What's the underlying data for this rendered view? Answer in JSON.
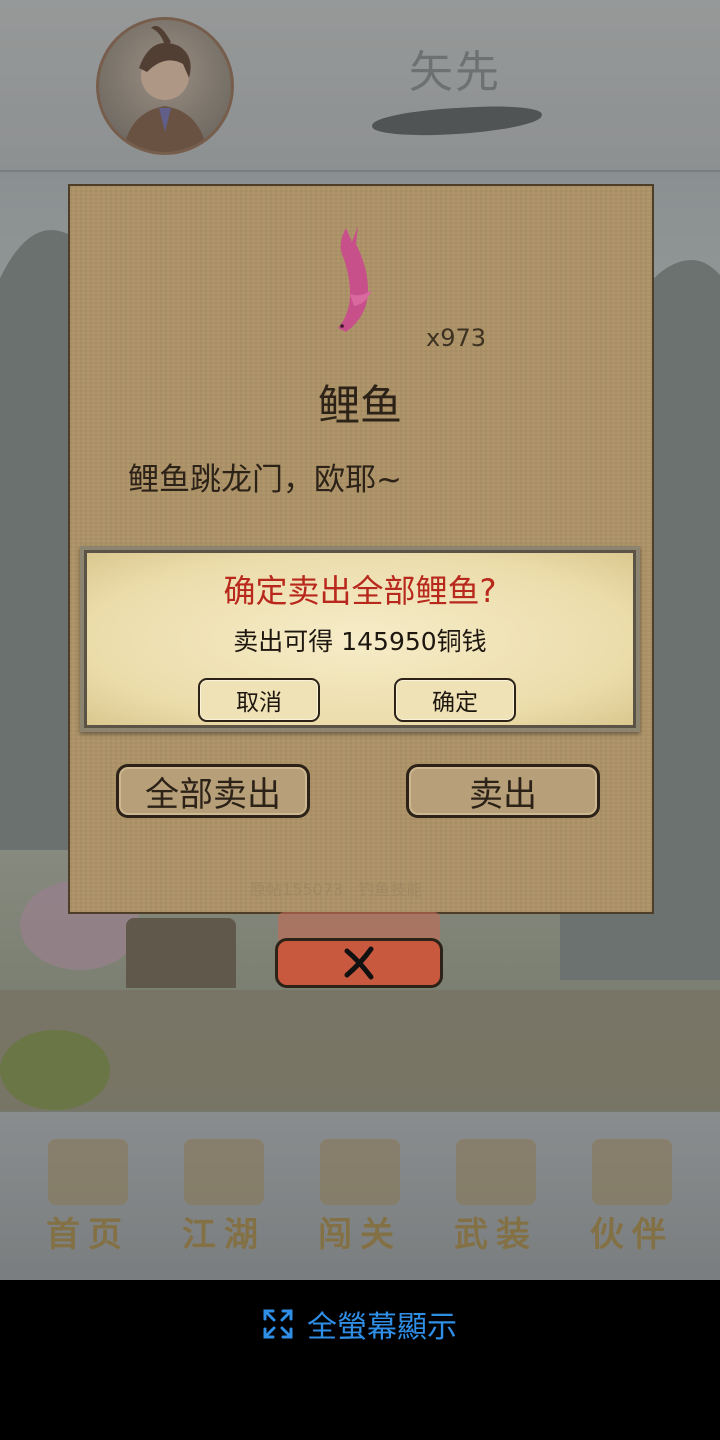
{
  "header": {
    "player_name": "矢先"
  },
  "item": {
    "name": "鲤鱼",
    "count": "x973",
    "description": "鲤鱼跳龙门，欧耶~",
    "icon": "pink-carp-icon",
    "icon_color": "#c8508a",
    "watermark": "原帖155073 · 钓鱼技能"
  },
  "actions": {
    "sell_all_label": "全部卖出",
    "sell_label": "卖出"
  },
  "close": {
    "icon": "close-x-icon"
  },
  "confirm": {
    "title": "确定卖出全部鲤鱼?",
    "text": "卖出可得 145950铜钱",
    "cancel_label": "取消",
    "ok_label": "确定",
    "title_color": "#b8281c"
  },
  "nav": {
    "items": [
      {
        "label": "首页",
        "icon": "home-building-icon"
      },
      {
        "label": "江湖",
        "icon": "scroll-icon"
      },
      {
        "label": "闯关",
        "icon": "crossed-swords-icon"
      },
      {
        "label": "武装",
        "icon": "armor-icon"
      },
      {
        "label": "伙伴",
        "icon": "partners-icon"
      }
    ]
  },
  "fullscreen": {
    "label": "全螢幕顯示",
    "icon": "expand-icon"
  }
}
